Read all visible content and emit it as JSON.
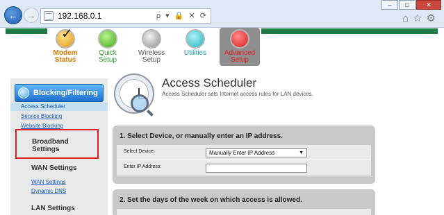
{
  "browser": {
    "url": "192.168.0.1",
    "address_tools": "ρ ▾ 🔒 ✕ ⟳"
  },
  "topnav": {
    "items": [
      {
        "l1": "Modem",
        "l2": "Status"
      },
      {
        "l1": "Quick",
        "l2": "Setup"
      },
      {
        "l1": "Wireless",
        "l2": "Setup"
      },
      {
        "l1": "Utilities",
        "l2": ""
      },
      {
        "l1": "Advanced",
        "l2": "Setup"
      }
    ]
  },
  "sidebar": {
    "header": "Blocking/Filtering",
    "sub_items": [
      "Access Scheduler",
      "Service Blocking",
      "Website Blocking"
    ],
    "broadband": {
      "l1": "Broadband",
      "l2": "Settings"
    },
    "wan": {
      "title": "WAN Settings",
      "items": [
        "WAN Settings",
        "Dynamic DNS"
      ]
    },
    "lan": {
      "title": "LAN Settings"
    }
  },
  "main": {
    "title": "Access Scheduler",
    "description": "Access Scheduler sets Internet access rules for LAN devices.",
    "section1": {
      "heading": "1. Select Device, or manually enter an IP address.",
      "device_label": "Select Device:",
      "device_value": "Manually Enter IP Address",
      "ip_label": "Enter IP Address:",
      "ip_value": ""
    },
    "section2": {
      "heading": "2. Set the days of the week on which access is allowed."
    }
  }
}
